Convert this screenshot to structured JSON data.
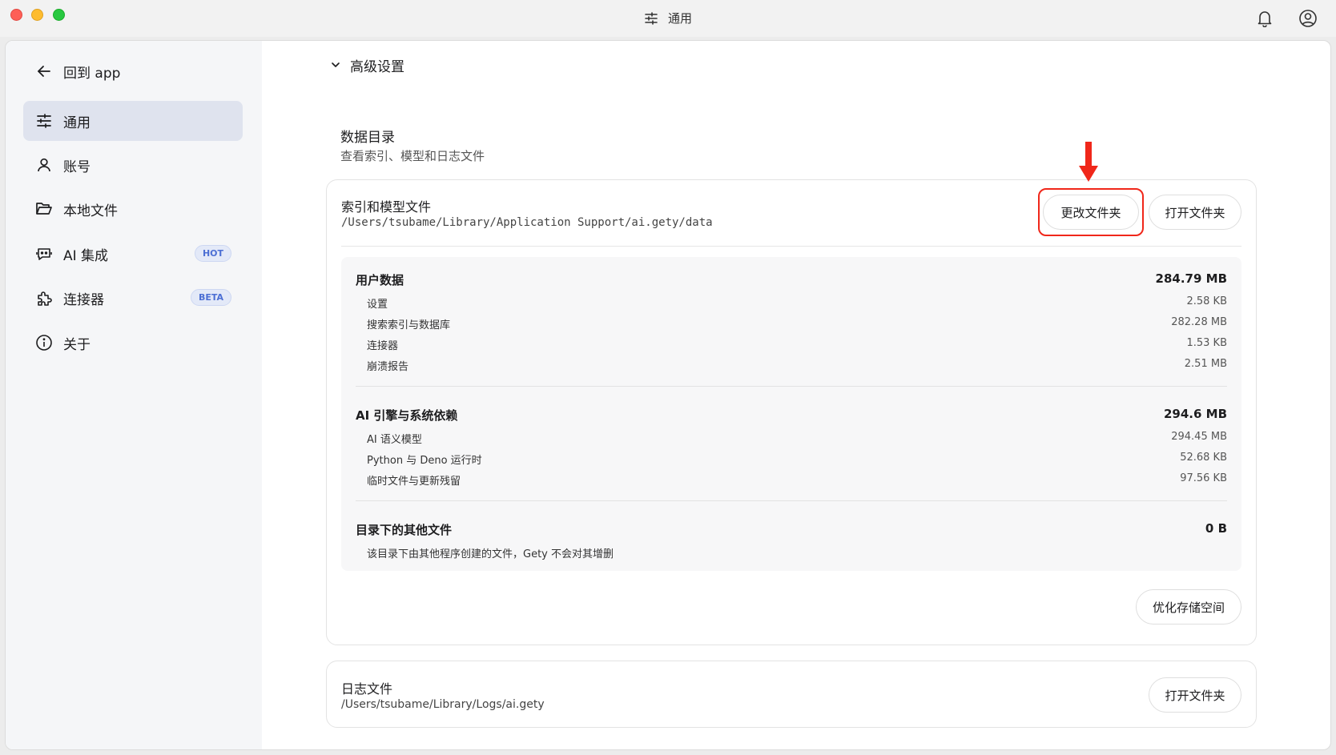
{
  "window": {
    "title": "通用"
  },
  "sidebar": {
    "items": [
      {
        "label": "回到 app"
      },
      {
        "label": "通用"
      },
      {
        "label": "账号"
      },
      {
        "label": "本地文件"
      },
      {
        "label": "AI 集成",
        "badge": "HOT"
      },
      {
        "label": "连接器",
        "badge": "BETA"
      },
      {
        "label": "关于"
      }
    ]
  },
  "main": {
    "section_header": "高级设置",
    "data_dir": {
      "title": "数据目录",
      "description": "查看索引、模型和日志文件"
    },
    "index_card": {
      "title": "索引和模型文件",
      "path": "/Users/tsubame/Library/Application Support/ai.gety/data",
      "change_button": "更改文件夹",
      "open_button": "打开文件夹",
      "optimize_button": "优化存储空间",
      "groups": [
        {
          "title": "用户数据",
          "total": "284.79 MB",
          "rows": [
            {
              "label": "设置",
              "value": "2.58 KB"
            },
            {
              "label": "搜索索引与数据库",
              "value": "282.28 MB"
            },
            {
              "label": "连接器",
              "value": "1.53 KB"
            },
            {
              "label": "崩溃报告",
              "value": "2.51 MB"
            }
          ]
        },
        {
          "title": "AI 引擎与系统依赖",
          "total": "294.6 MB",
          "rows": [
            {
              "label": "AI 语义模型",
              "value": "294.45 MB"
            },
            {
              "label": "Python 与 Deno 运行时",
              "value": "52.68 KB"
            },
            {
              "label": "临时文件与更新残留",
              "value": "97.56 KB"
            }
          ]
        },
        {
          "title": "目录下的其他文件",
          "total": "0 B",
          "note": "该目录下由其他程序创建的文件，Gety 不会对其增删"
        }
      ]
    },
    "log_card": {
      "title": "日志文件",
      "path": "/Users/tsubame/Library/Logs/ai.gety",
      "open_button": "打开文件夹"
    }
  },
  "colors": {
    "accent_highlight": "#f0271a",
    "active_bg": "#dfe3ee",
    "badge": "#4c6fd4"
  }
}
